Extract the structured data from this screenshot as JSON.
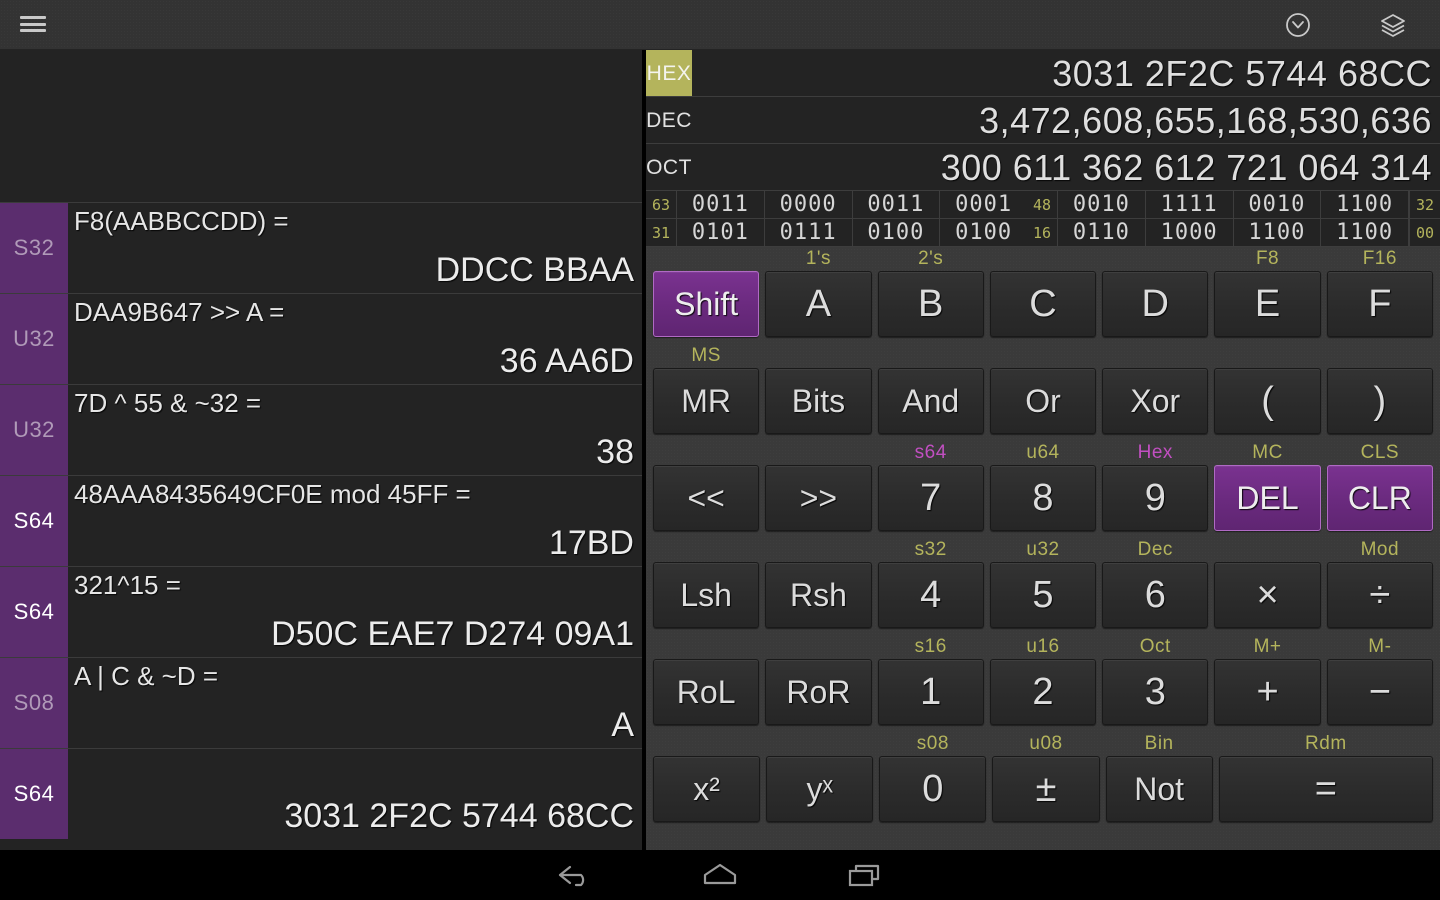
{
  "appbar": {
    "menu_icon": "hamburger-menu-icon",
    "history_icon": "clock-history-icon",
    "layers_icon": "layers-stack-icon"
  },
  "history": {
    "rows": [
      {
        "tag": "S32",
        "tag_state": "dim",
        "expr": "F8(AABBCCDD) =",
        "result": "DDCC BBAA"
      },
      {
        "tag": "U32",
        "tag_state": "dim",
        "expr": "DAA9B647 >> A =",
        "result": "36 AA6D"
      },
      {
        "tag": "U32",
        "tag_state": "dim",
        "expr": "7D ^ 55 & ~32 =",
        "result": "38"
      },
      {
        "tag": "S64",
        "tag_state": "bright",
        "expr": "48AAA8435649CF0E mod 45FF =",
        "result": "17BD"
      },
      {
        "tag": "S64",
        "tag_state": "bright",
        "expr": "321^15 =",
        "result": "D50C EAE7 D274 09A1"
      },
      {
        "tag": "S08",
        "tag_state": "dim",
        "expr": "A | C & ~D =",
        "result": "A"
      },
      {
        "tag": "S64",
        "tag_state": "bright",
        "expr": "",
        "result": "3031 2F2C 5744 68CC"
      }
    ]
  },
  "display": {
    "rows": [
      {
        "label": "HEX",
        "active": true,
        "value": "3031 2F2C 5744 68CC"
      },
      {
        "label": "DEC",
        "active": false,
        "value": "3,472,608,655,168,530,636"
      },
      {
        "label": "OCT",
        "active": false,
        "value": "300 611 362 612 721 064 314"
      }
    ],
    "binary": [
      {
        "start_index": "63",
        "mid_index": "48",
        "end_index": "32",
        "nibbles": [
          "0011",
          "0000",
          "0011",
          "0001",
          "0010",
          "1111",
          "0010",
          "1100"
        ]
      },
      {
        "start_index": "31",
        "mid_index": "16",
        "end_index": "00",
        "nibbles": [
          "0101",
          "0111",
          "0100",
          "0100",
          "0110",
          "1000",
          "1100",
          "1100"
        ]
      }
    ]
  },
  "keypad": {
    "rows": [
      {
        "keys": [
          {
            "top": "",
            "label": "Shift",
            "style": "purple",
            "size": "small"
          },
          {
            "top": "1's",
            "label": "A",
            "style": "normal",
            "size": "normal"
          },
          {
            "top": "2's",
            "label": "B",
            "style": "normal",
            "size": "normal"
          },
          {
            "top": "",
            "label": "C",
            "style": "normal",
            "size": "normal"
          },
          {
            "top": "",
            "label": "D",
            "style": "normal",
            "size": "normal"
          },
          {
            "top": "F8",
            "label": "E",
            "style": "normal",
            "size": "normal"
          },
          {
            "top": "F16",
            "label": "F",
            "style": "normal",
            "size": "normal"
          }
        ]
      },
      {
        "keys": [
          {
            "top": "MS",
            "label": "MR",
            "style": "normal",
            "size": "small"
          },
          {
            "top": "",
            "label": "Bits",
            "style": "normal",
            "size": "small"
          },
          {
            "top": "",
            "label": "And",
            "style": "normal",
            "size": "small"
          },
          {
            "top": "",
            "label": "Or",
            "style": "normal",
            "size": "small"
          },
          {
            "top": "",
            "label": "Xor",
            "style": "normal",
            "size": "small"
          },
          {
            "top": "",
            "label": "(",
            "style": "normal",
            "size": "normal"
          },
          {
            "top": "",
            "label": ")",
            "style": "normal",
            "size": "normal"
          }
        ]
      },
      {
        "keys": [
          {
            "top": "",
            "label": "<<",
            "style": "normal",
            "size": "small"
          },
          {
            "top": "",
            "label": ">>",
            "style": "normal",
            "size": "small"
          },
          {
            "top": "s64",
            "top_color": "magenta",
            "label": "7",
            "style": "normal",
            "size": "normal"
          },
          {
            "top": "u64",
            "label": "8",
            "style": "normal",
            "size": "normal"
          },
          {
            "top": "Hex",
            "top_color": "magenta",
            "label": "9",
            "style": "normal",
            "size": "normal"
          },
          {
            "top": "MC",
            "label": "DEL",
            "style": "purple",
            "size": "small"
          },
          {
            "top": "CLS",
            "label": "CLR",
            "style": "purple",
            "size": "small"
          }
        ]
      },
      {
        "keys": [
          {
            "top": "",
            "label": "Lsh",
            "style": "normal",
            "size": "small"
          },
          {
            "top": "",
            "label": "Rsh",
            "style": "normal",
            "size": "small"
          },
          {
            "top": "s32",
            "label": "4",
            "style": "normal",
            "size": "normal"
          },
          {
            "top": "u32",
            "label": "5",
            "style": "normal",
            "size": "normal"
          },
          {
            "top": "Dec",
            "label": "6",
            "style": "normal",
            "size": "normal"
          },
          {
            "top": "",
            "label": "×",
            "style": "normal",
            "size": "normal"
          },
          {
            "top": "Mod",
            "label": "÷",
            "style": "normal",
            "size": "normal"
          }
        ]
      },
      {
        "keys": [
          {
            "top": "",
            "label": "RoL",
            "style": "normal",
            "size": "small"
          },
          {
            "top": "",
            "label": "RoR",
            "style": "normal",
            "size": "small"
          },
          {
            "top": "s16",
            "label": "1",
            "style": "normal",
            "size": "normal"
          },
          {
            "top": "u16",
            "label": "2",
            "style": "normal",
            "size": "normal"
          },
          {
            "top": "Oct",
            "label": "3",
            "style": "normal",
            "size": "normal"
          },
          {
            "top": "M+",
            "label": "+",
            "style": "normal",
            "size": "normal"
          },
          {
            "top": "M-",
            "label": "−",
            "style": "normal",
            "size": "normal"
          }
        ]
      },
      {
        "keys": [
          {
            "top": "",
            "label": "x²",
            "style": "normal",
            "size": "small"
          },
          {
            "top": "",
            "label": "yˣ",
            "style": "normal",
            "size": "small"
          },
          {
            "top": "s08",
            "label": "0",
            "style": "normal",
            "size": "normal"
          },
          {
            "top": "u08",
            "label": "±",
            "style": "normal",
            "size": "normal"
          },
          {
            "top": "Bin",
            "label": "Not",
            "style": "normal",
            "size": "small"
          },
          {
            "top": "Rdm",
            "label": "=",
            "style": "normal",
            "size": "normal",
            "wide": true
          }
        ]
      }
    ]
  },
  "navbar": {
    "back_icon": "back-arrow-icon",
    "home_icon": "home-icon",
    "recents_icon": "recent-apps-icon"
  },
  "colors": {
    "accent_purple": "#5b2d6e",
    "key_purple": "#6a2a7e",
    "label_olive": "#b4b45c",
    "label_magenta": "#c14fc1",
    "panel_dark": "#232323",
    "keypad_bg": "#3a3a3a"
  }
}
